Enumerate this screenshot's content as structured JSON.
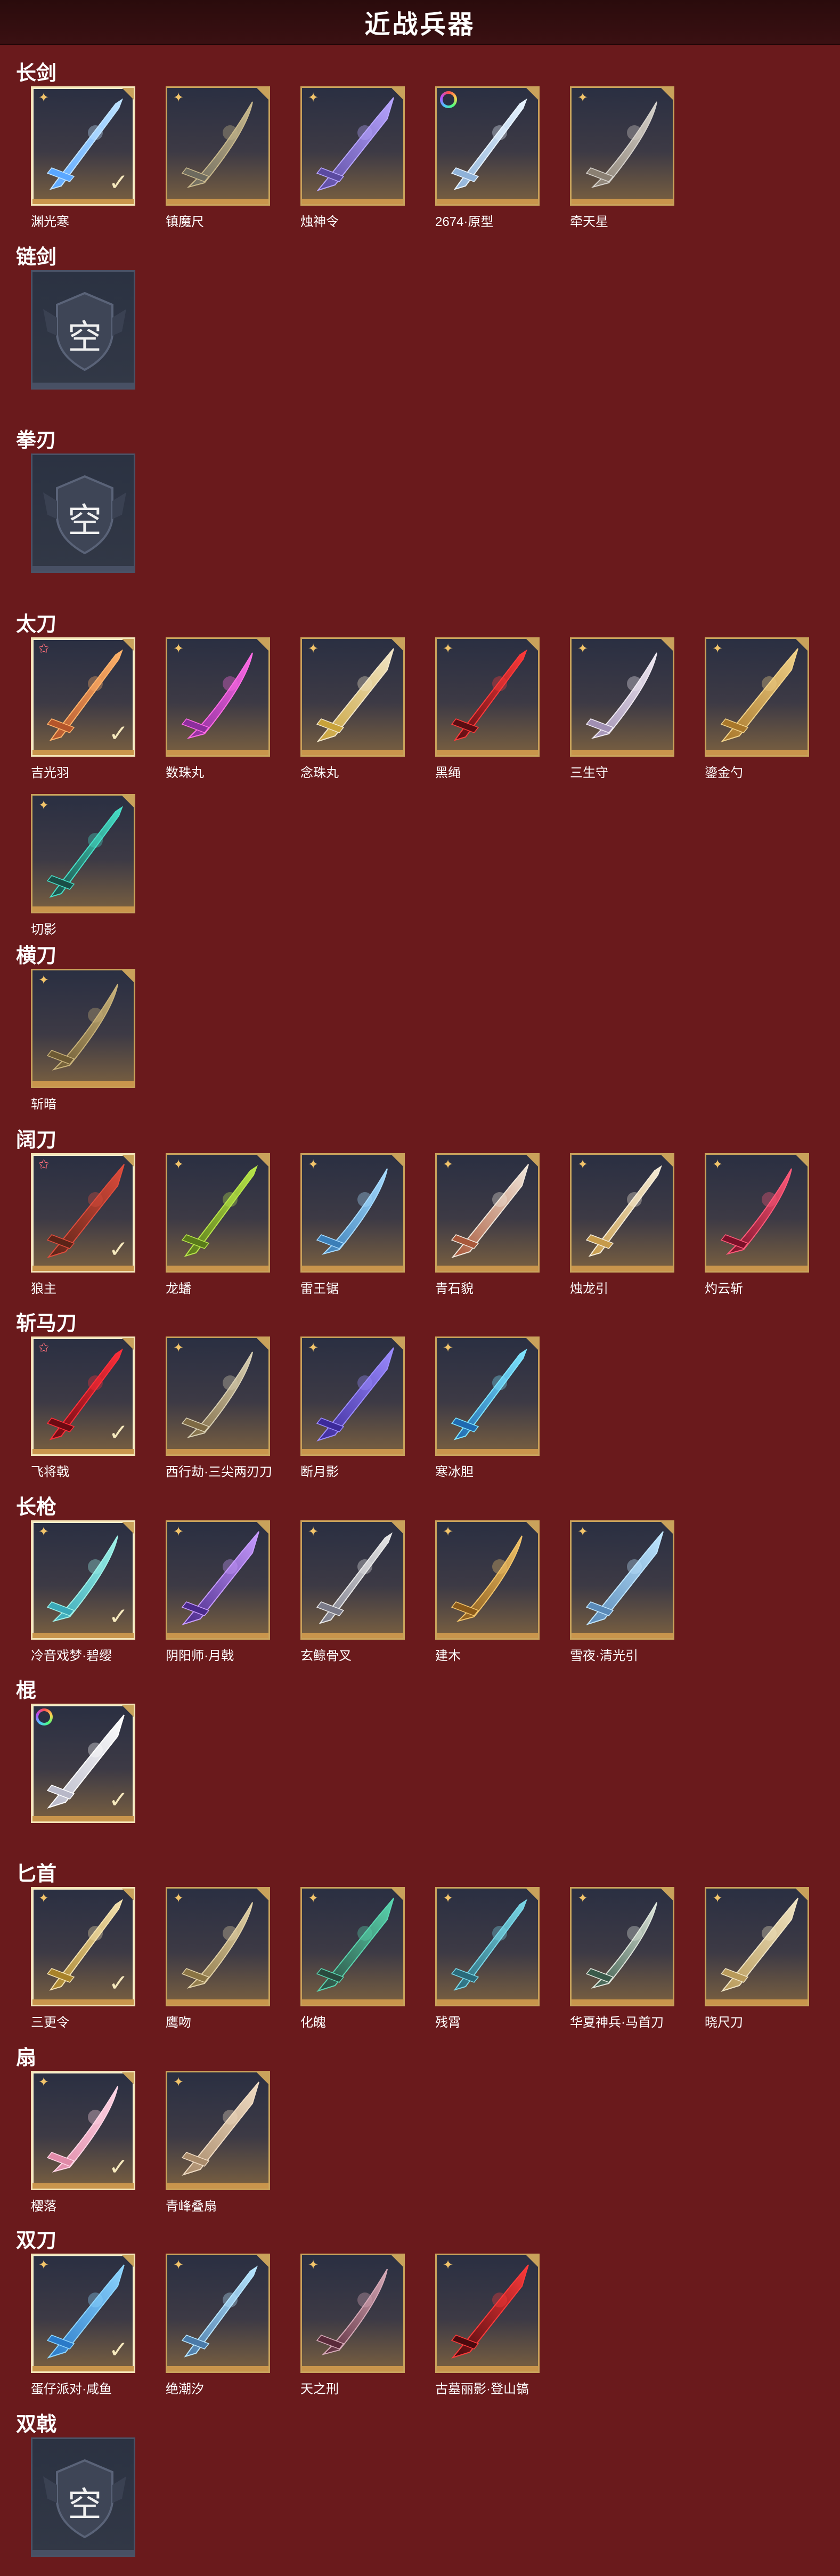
{
  "page": {
    "title": "近战兵器",
    "colors": {
      "background": "#6a1a1c",
      "header": "#2a0b0c",
      "card_border": "#c9a25b",
      "equipped_border": "#f3e3b6",
      "star_rarity": "#ff6f7a",
      "gold_rarity": "#f2c46a"
    }
  },
  "categories": [
    {
      "title": "长剑",
      "items": [
        {
          "name": "渊光寒",
          "rarity": "gold-cross",
          "equipped": true,
          "palette": [
            "#bfe3ff",
            "#5aa7ff"
          ]
        },
        {
          "name": "镇魔尺",
          "rarity": "gold-cross",
          "equipped": false,
          "palette": [
            "#c9b98d",
            "#6d6a5e"
          ]
        },
        {
          "name": "烛神令",
          "rarity": "gold-cross",
          "equipped": false,
          "palette": [
            "#b8a6ff",
            "#5b4aa0"
          ]
        },
        {
          "name": "2674·原型",
          "rarity": "rainbow-ring",
          "equipped": false,
          "palette": [
            "#e8f4ff",
            "#8fb2d8"
          ]
        },
        {
          "name": "牵天星",
          "rarity": "gold-cross",
          "equipped": false,
          "palette": [
            "#d6d2cc",
            "#8a7f72"
          ]
        }
      ]
    },
    {
      "title": "链剑",
      "items": [],
      "empty_label": "空"
    },
    {
      "title": "拳刃",
      "items": [],
      "empty_label": "空"
    },
    {
      "title": "太刀",
      "items": [
        {
          "name": "吉光羽",
          "rarity": "star",
          "equipped": true,
          "palette": [
            "#ffb36b",
            "#b4552b"
          ]
        },
        {
          "name": "数珠丸",
          "rarity": "gold-cross",
          "equipped": false,
          "palette": [
            "#ff6ce6",
            "#8c2e9c"
          ]
        },
        {
          "name": "念珠丸",
          "rarity": "gold-cross",
          "equipped": false,
          "palette": [
            "#f2e6c8",
            "#c8a23a"
          ]
        },
        {
          "name": "黑绳",
          "rarity": "gold-cross",
          "equipped": false,
          "palette": [
            "#ff3a3a",
            "#5a0d12"
          ]
        },
        {
          "name": "三生守",
          "rarity": "gold-cross",
          "equipped": false,
          "palette": [
            "#efe9f2",
            "#a08fb2"
          ]
        },
        {
          "name": "鎏金勺",
          "rarity": "gold-cross",
          "equipped": false,
          "palette": [
            "#f1d28a",
            "#a8772a"
          ]
        },
        {
          "name": "切影",
          "rarity": "gold-cross",
          "equipped": false,
          "palette": [
            "#47e0c8",
            "#1a4d46"
          ]
        }
      ]
    },
    {
      "title": "横刀",
      "items": [
        {
          "name": "斩暗",
          "rarity": "gold-cross",
          "equipped": false,
          "palette": [
            "#c8b27a",
            "#6d5a34"
          ]
        }
      ]
    },
    {
      "title": "阔刀",
      "items": [
        {
          "name": "狼主",
          "rarity": "star",
          "equipped": true,
          "palette": [
            "#e04c3c",
            "#5a2418"
          ]
        },
        {
          "name": "龙蟠",
          "rarity": "gold-cross",
          "equipped": false,
          "palette": [
            "#b8e64a",
            "#5a7a1a"
          ]
        },
        {
          "name": "雷王锯",
          "rarity": "gold-cross",
          "equipped": false,
          "palette": [
            "#a8dcff",
            "#3b7fb8"
          ]
        },
        {
          "name": "青石貌",
          "rarity": "gold-cross",
          "equipped": false,
          "palette": [
            "#f2e8dc",
            "#a8583a"
          ]
        },
        {
          "name": "烛龙引",
          "rarity": "gold-cross",
          "equipped": false,
          "palette": [
            "#f5ecd8",
            "#c69a4a"
          ]
        },
        {
          "name": "灼云斩",
          "rarity": "gold-cross",
          "equipped": false,
          "palette": [
            "#ff5a7a",
            "#7a1028"
          ]
        }
      ]
    },
    {
      "title": "斩马刀",
      "items": [
        {
          "name": "飞将戟",
          "rarity": "star",
          "equipped": true,
          "palette": [
            "#ff2f3a",
            "#6d0a12"
          ]
        },
        {
          "name": "西行劫·三尖两刃刀",
          "rarity": "gold-cross",
          "equipped": false,
          "palette": [
            "#d9d0b4",
            "#7e6a44"
          ]
        },
        {
          "name": "断月影",
          "rarity": "gold-cross",
          "equipped": false,
          "palette": [
            "#9c8cff",
            "#3c2a9a"
          ]
        },
        {
          "name": "寒冰胆",
          "rarity": "gold-cross",
          "equipped": false,
          "palette": [
            "#7fe6ff",
            "#1f6ab0"
          ]
        }
      ]
    },
    {
      "title": "长枪",
      "items": [
        {
          "name": "冷音戏梦·碧缨",
          "rarity": "gold-cross",
          "equipped": true,
          "palette": [
            "#9ff2e8",
            "#3aa8b8"
          ]
        },
        {
          "name": "阴阳师·月戟",
          "rarity": "gold-cross",
          "equipped": false,
          "palette": [
            "#c89cff",
            "#4a2a8a"
          ]
        },
        {
          "name": "玄鲸骨叉",
          "rarity": "gold-cross",
          "equipped": false,
          "palette": [
            "#e8e8e8",
            "#7a7a88"
          ]
        },
        {
          "name": "建木",
          "rarity": "gold-cross",
          "equipped": false,
          "palette": [
            "#f2c46a",
            "#8a5a1a"
          ]
        },
        {
          "name": "雪夜·清光引",
          "rarity": "gold-cross",
          "equipped": false,
          "palette": [
            "#bfe6ff",
            "#5a8ab8"
          ]
        }
      ]
    },
    {
      "title": "棍",
      "items": [
        {
          "name": "",
          "rarity": "rainbow-ring",
          "equipped": true,
          "palette": [
            "#ffffff",
            "#b8b8c8"
          ]
        }
      ]
    },
    {
      "title": "匕首",
      "items": [
        {
          "name": "三更令",
          "rarity": "gold-cross",
          "equipped": true,
          "palette": [
            "#f4e2b0",
            "#a8822a"
          ]
        },
        {
          "name": "鹰吻",
          "rarity": "gold-cross",
          "equipped": false,
          "palette": [
            "#e2d2a8",
            "#8a7444"
          ]
        },
        {
          "name": "化魄",
          "rarity": "gold-cross",
          "equipped": false,
          "palette": [
            "#5ad6b0",
            "#2a4a3e"
          ]
        },
        {
          "name": "残霄",
          "rarity": "gold-cross",
          "equipped": false,
          "palette": [
            "#7ad8e8",
            "#2a6a7a"
          ]
        },
        {
          "name": "华夏神兵·马首刀",
          "rarity": "gold-cross",
          "equipped": false,
          "palette": [
            "#dfe6dc",
            "#3a5a4a"
          ]
        },
        {
          "name": "晓尺刀",
          "rarity": "gold-cross",
          "equipped": false,
          "palette": [
            "#f0e4c4",
            "#b89a5a"
          ]
        }
      ]
    },
    {
      "title": "扇",
      "items": [
        {
          "name": "樱落",
          "rarity": "gold-cross",
          "equipped": true,
          "palette": [
            "#ffd6e6",
            "#e08aa8"
          ]
        },
        {
          "name": "青峰叠扇",
          "rarity": "gold-cross",
          "equipped": false,
          "palette": [
            "#f0dcc4",
            "#a88a6a"
          ]
        }
      ]
    },
    {
      "title": "双刀",
      "items": [
        {
          "name": "蛋仔派对·咸鱼",
          "rarity": "gold-cross",
          "equipped": true,
          "palette": [
            "#8fd6ff",
            "#2a7ac8"
          ]
        },
        {
          "name": "绝潮汐",
          "rarity": "gold-cross",
          "equipped": false,
          "palette": [
            "#b8e6ff",
            "#4a7aa8"
          ]
        },
        {
          "name": "天之刑",
          "rarity": "gold-cross",
          "equipped": false,
          "palette": [
            "#d6aab8",
            "#5a2a3a"
          ]
        },
        {
          "name": "古墓丽影·登山镐",
          "rarity": "gold-cross",
          "equipped": false,
          "palette": [
            "#ff3a3a",
            "#4a0a0e"
          ]
        }
      ]
    },
    {
      "title": "双戟",
      "items": [],
      "empty_label": "空"
    }
  ]
}
